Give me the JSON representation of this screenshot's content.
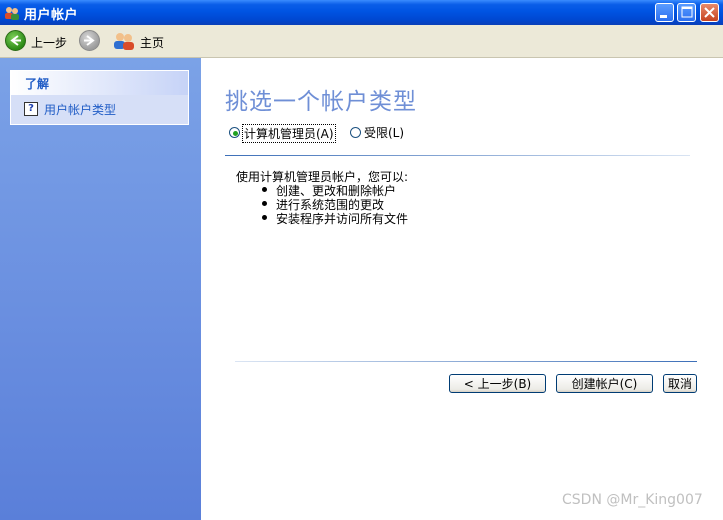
{
  "window": {
    "title": "用户帐户"
  },
  "toolbar": {
    "back_label": "上一步",
    "home_label": "主页"
  },
  "sidebar": {
    "section_title": "了解",
    "links": [
      {
        "label": "用户帐户类型",
        "icon": "help-icon"
      }
    ]
  },
  "main": {
    "title": "挑选一个帐户类型",
    "options": [
      {
        "label": "计算机管理员(A)",
        "selected": true
      },
      {
        "label": "受限(L)",
        "selected": false
      }
    ],
    "description": {
      "intro": "使用计算机管理员帐户，您可以:",
      "bullets": [
        "创建、更改和删除帐户",
        "进行系统范围的更改",
        "安装程序并访问所有文件"
      ]
    }
  },
  "buttons": {
    "back": "< 上一步(B)",
    "create": "创建帐户(C)",
    "cancel": "取消"
  },
  "watermark": "CSDN @Mr_King007",
  "colors": {
    "titlebar": "#0054e3",
    "sidebar": "#6a8fe0",
    "title_text": "#6f8fd6",
    "link": "#215dc6"
  }
}
